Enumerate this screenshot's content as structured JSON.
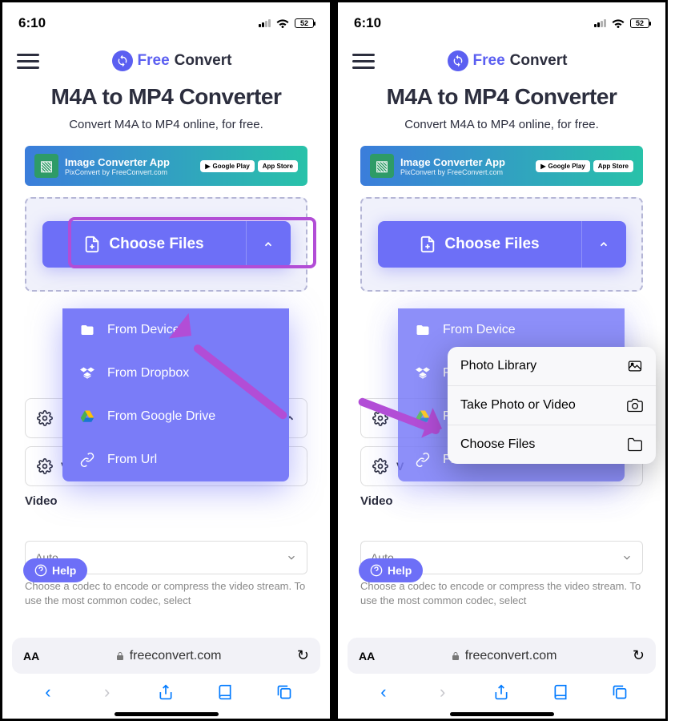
{
  "status": {
    "time": "6:10",
    "battery": "52"
  },
  "brand": {
    "free": "Free",
    "convert": "Convert"
  },
  "title": "M4A to MP4 Converter",
  "subtitle": "Convert M4A to MP4 online, for free.",
  "ad": {
    "title": "Image Converter App",
    "subtitle": "PixConvert by FreeConvert.com",
    "badge1": "Google Play",
    "badge2": "App Store"
  },
  "choose_label": "Choose Files",
  "menu": {
    "device": "From Device",
    "dropbox": "From Dropbox",
    "gdrive": "From Google Drive",
    "url": "From Url"
  },
  "ios_menu": {
    "photo": "Photo Library",
    "take": "Take Photo or Video",
    "choose": "Choose Files"
  },
  "settings": {
    "v_label": "V"
  },
  "video": {
    "codec_label": "Video",
    "codec_value": "Auto",
    "help": "Choose a codec to encode or compress the video stream. To use the most common codec, select"
  },
  "help_pill": "Help",
  "url": "freeconvert.com",
  "aa": "AA"
}
